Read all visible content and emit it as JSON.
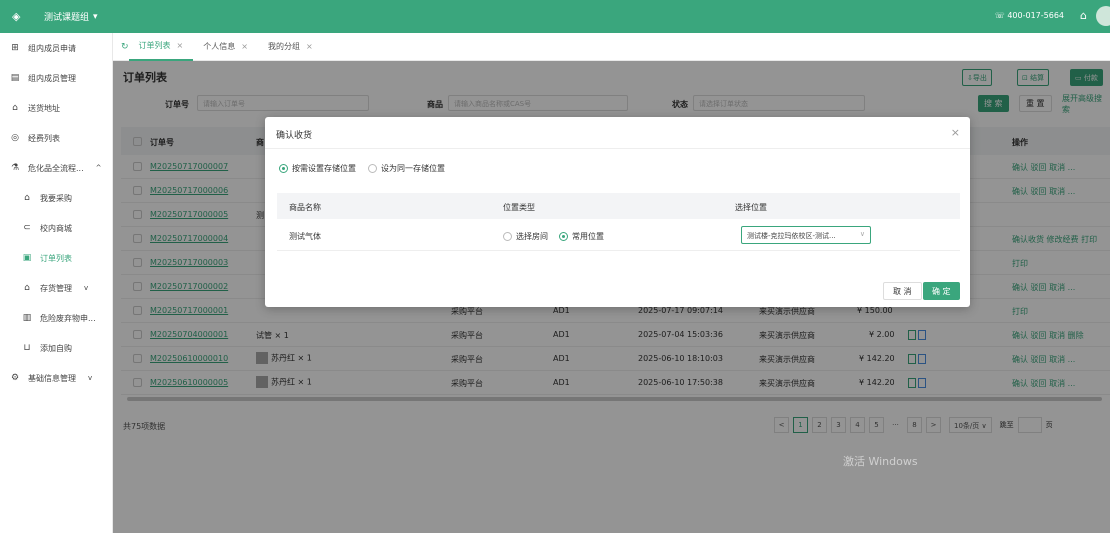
{
  "topbar": {
    "team": "测试课题组",
    "team_caret": "▾",
    "phone": "☏ 400-017-5664"
  },
  "sidebar": {
    "items": [
      {
        "label": "组内成员申请"
      },
      {
        "label": "组内成员管理"
      },
      {
        "label": "送货地址"
      },
      {
        "label": "经费列表"
      },
      {
        "label": "危化品全流程...",
        "caret": "^"
      },
      {
        "label": "我要采购"
      },
      {
        "label": "校内商城"
      },
      {
        "label": "订单列表"
      },
      {
        "label": "存货管理",
        "caret": "v"
      },
      {
        "label": "危险废弃物申..."
      },
      {
        "label": "添加自购"
      },
      {
        "label": "基础信息管理",
        "caret": "v"
      }
    ]
  },
  "tabs": [
    {
      "label": "订单列表",
      "close": "×"
    },
    {
      "label": "个人信息",
      "close": "×"
    },
    {
      "label": "我的分组",
      "close": "×"
    }
  ],
  "main": {
    "title": "订单列表",
    "buttons": {
      "export": "⇩导出",
      "settle": "⊡ 结算",
      "pay": "▭ 付款"
    },
    "filters": {
      "order_label": "订单号",
      "order_placeholder": "请输入订单号",
      "product_label": "商品",
      "product_placeholder": "请输入商品名称或CAS号",
      "status_label": "状态",
      "status_placeholder": "请选择订单状态",
      "search": "搜 索",
      "reset": "重 置",
      "advanced": "展开高级搜索"
    },
    "table": {
      "headers": {
        "order_no": "订单号",
        "product": "商",
        "ops": "操作"
      },
      "rows": [
        {
          "order_no": "M20250717000007",
          "product": "",
          "source": "",
          "code": "",
          "time": "",
          "supplier": "",
          "price": "",
          "ops": "确认 驳回 取消 ..."
        },
        {
          "order_no": "M20250717000006",
          "product": "",
          "source": "",
          "code": "",
          "time": "",
          "supplier": "",
          "price": "",
          "ops": "确认 驳回 取消 ..."
        },
        {
          "order_no": "M20250717000005",
          "product": "测",
          "source": "",
          "code": "",
          "time": "",
          "supplier": "",
          "price": "",
          "ops": ""
        },
        {
          "order_no": "M20250717000004",
          "product": "",
          "source": "",
          "code": "",
          "time": "",
          "supplier": "",
          "price": "",
          "ops": "确认收货 修改经费 打印"
        },
        {
          "order_no": "M20250717000003",
          "product": "",
          "source": "",
          "code": "",
          "time": "",
          "supplier": "",
          "price": "",
          "ops": "打印"
        },
        {
          "order_no": "M20250717000002",
          "product": "",
          "source": "",
          "code": "",
          "time": "",
          "supplier": "",
          "price": "",
          "ops": "确认 驳回 取消 ..."
        },
        {
          "order_no": "M20250717000001",
          "product": "",
          "source": "采购平台",
          "code": "AD1",
          "time": "2025-07-17 09:07:14",
          "supplier": "来买演示供应商",
          "price": "¥ 150.00",
          "ops": "打印"
        },
        {
          "order_no": "M20250704000001",
          "product": "试管 × 1",
          "source": "采购平台",
          "code": "AD1",
          "time": "2025-07-04 15:03:36",
          "supplier": "来买演示供应商",
          "price": "¥ 2.00",
          "ops": "确认 驳回 取消 删除"
        },
        {
          "order_no": "M20250610000010",
          "product": "苏丹红 × 1",
          "source": "采购平台",
          "code": "AD1",
          "time": "2025-06-10 18:10:03",
          "supplier": "来买演示供应商",
          "price": "¥ 142.20",
          "ops": "确认 驳回 取消 ..."
        },
        {
          "order_no": "M20250610000005",
          "product": "苏丹红 × 1",
          "source": "采购平台",
          "code": "AD1",
          "time": "2025-06-10 17:50:38",
          "supplier": "来买演示供应商",
          "price": "¥ 142.20",
          "ops": "确认 驳回 取消 ..."
        }
      ]
    },
    "total": "共75项数据",
    "pagination": {
      "prev": "<",
      "pages": [
        "1",
        "2",
        "3",
        "4",
        "5"
      ],
      "ellipsis": "···",
      "last": "8",
      "next": ">",
      "per_page": "10条/页 ∨",
      "goto": "跳至",
      "page_unit": "页"
    },
    "watermark": "激活 Windows"
  },
  "modal": {
    "title": "确认收货",
    "close": "×",
    "radio1": "按需设置存储位置",
    "radio2": "设为同一存储位置",
    "headers": {
      "name": "商品名称",
      "type": "位置类型",
      "location": "选择位置"
    },
    "row": {
      "name": "测试气体",
      "room": "选择房间",
      "common": "常用位置",
      "location_value": "测试楼-克拉玛依校区-测试...",
      "caret": "∨"
    },
    "cancel": "取 消",
    "confirm": "确 定"
  },
  "colors": {
    "accent": "#3aa67d"
  },
  "icons": {
    "logo": "layers-icon",
    "home": "home-icon"
  }
}
